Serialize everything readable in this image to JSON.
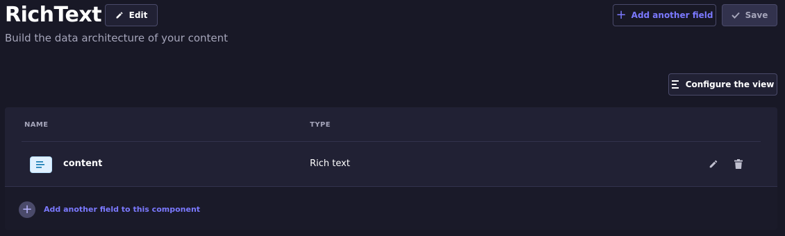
{
  "header": {
    "title": "RichText",
    "subtitle": "Build the data architecture of your content",
    "edit_label": "Edit",
    "add_field_label": "Add another field",
    "save_label": "Save"
  },
  "toolbar": {
    "configure_label": "Configure the view"
  },
  "table": {
    "columns": [
      "NAME",
      "TYPE"
    ],
    "rows": [
      {
        "name": "content",
        "type": "Rich text",
        "icon": "rich-text-icon"
      }
    ]
  },
  "footer": {
    "add_component_field_label": "Add another field to this component"
  },
  "colors": {
    "background": "#181826",
    "panel": "#212134",
    "accent": "#7b79ff",
    "text_muted": "#a5a5ba"
  }
}
